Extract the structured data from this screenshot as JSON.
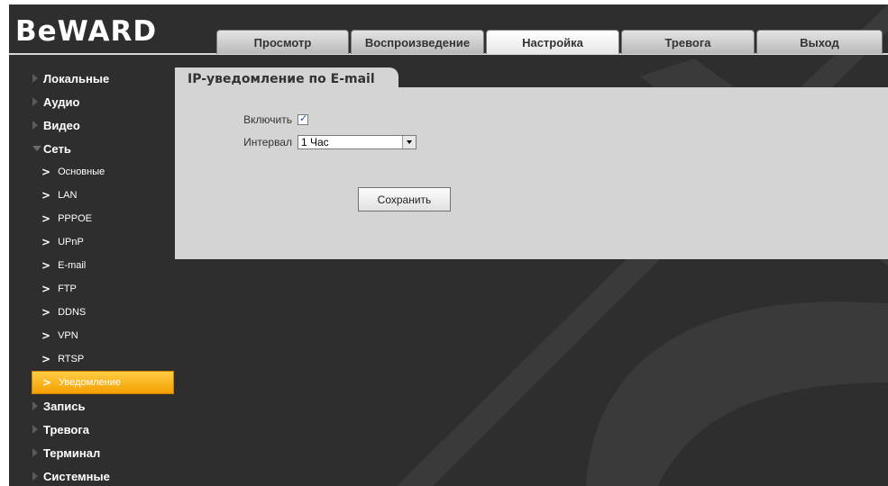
{
  "app": {
    "logo": "BeWARD"
  },
  "tabs": [
    {
      "label": "Просмотр",
      "active": false
    },
    {
      "label": "Воспроизведение",
      "active": false
    },
    {
      "label": "Настройка",
      "active": true
    },
    {
      "label": "Тревога",
      "active": false
    },
    {
      "label": "Выход",
      "active": false
    }
  ],
  "sidebar": {
    "items": [
      {
        "label": "Локальные"
      },
      {
        "label": "Аудио"
      },
      {
        "label": "Видео"
      },
      {
        "label": "Сеть",
        "expanded": true
      }
    ],
    "sub_items": [
      {
        "label": "Основные"
      },
      {
        "label": "LAN"
      },
      {
        "label": "PPPOE"
      },
      {
        "label": "UPnP"
      },
      {
        "label": "E-mail"
      },
      {
        "label": "FTP"
      },
      {
        "label": "DDNS"
      },
      {
        "label": "VPN"
      },
      {
        "label": "RTSP"
      },
      {
        "label": "Уведомление",
        "active": true
      }
    ],
    "items_after": [
      {
        "label": "Запись"
      },
      {
        "label": "Тревога"
      },
      {
        "label": "Терминал"
      },
      {
        "label": "Системные"
      }
    ],
    "chevron": ">"
  },
  "panel": {
    "title": "IP-уведомление по E-mail",
    "enable_label": "Включить",
    "enable_checked": true,
    "interval_label": "Интервал",
    "interval_value": "1 Час",
    "save_label": "Сохранить"
  },
  "colors": {
    "background": "#2e2e2e",
    "panel": "#d4d4d4",
    "active_item": "#f5a000"
  }
}
